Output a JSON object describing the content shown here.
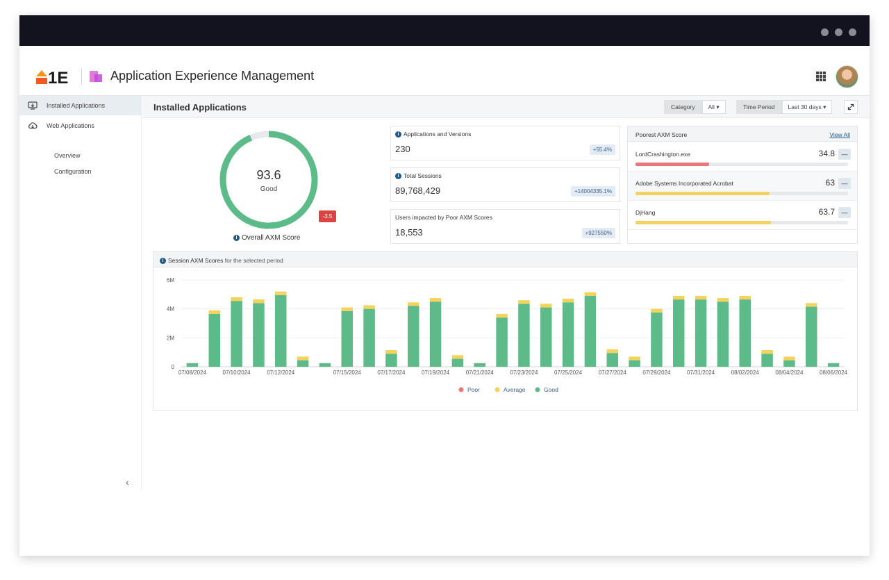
{
  "app": {
    "title": "Application Experience Management",
    "logo_text": "1E"
  },
  "sidebar": {
    "items": [
      {
        "label": "Installed Applications",
        "icon": "monitor-download-icon"
      },
      {
        "label": "Web Applications",
        "icon": "cloud-download-icon"
      }
    ],
    "subitems": [
      {
        "label": "Overview"
      },
      {
        "label": "Configuration"
      }
    ],
    "collapse_glyph": "‹"
  },
  "topbar": {
    "title": "Installed Applications",
    "category_label": "Category",
    "category_value": "All",
    "period_label": "Time Period",
    "period_value": "Last 30 days"
  },
  "score": {
    "value": "93.6",
    "rating": "Good",
    "delta": "-3.5",
    "caption": "Overall AXM Score",
    "fraction": 0.936,
    "color": "#5dbb8a"
  },
  "stats": [
    {
      "title": "Applications and Versions",
      "value": "230",
      "delta": "+55.4%",
      "info": true
    },
    {
      "title": "Total Sessions",
      "value": "89,768,429",
      "delta": "+14004335.1%",
      "info": true
    },
    {
      "title": "Users impacted by Poor AXM Scores",
      "value": "18,553",
      "delta": "+927550%",
      "info": false
    }
  ],
  "poorest": {
    "title": "Poorest AXM Score",
    "view_all": "View All",
    "rows": [
      {
        "name": "LordCrashington.exe",
        "score": "34.8",
        "fraction": 0.348,
        "color": "#e8787b"
      },
      {
        "name": "Adobe Systems Incorporated Acrobat",
        "score": "63",
        "fraction": 0.63,
        "color": "#f3d35e"
      },
      {
        "name": "DjHang",
        "score": "63.7",
        "fraction": 0.637,
        "color": "#f3d35e"
      }
    ],
    "button_glyph": "—"
  },
  "chart_title": {
    "bold": "Session AXM Scores",
    "rest": " for the selected period"
  },
  "chart_data": {
    "type": "bar",
    "stacked": true,
    "ylim": [
      0,
      6000000
    ],
    "yticks": [
      0,
      2000000,
      4000000,
      6000000
    ],
    "ytick_labels": [
      "0",
      "2M",
      "4M",
      "6M"
    ],
    "categories": [
      "07/08/2024",
      "07/09/2024",
      "07/10/2024",
      "07/11/2024",
      "07/12/2024",
      "07/13/2024",
      "07/14/2024",
      "07/15/2024",
      "07/16/2024",
      "07/17/2024",
      "07/18/2024",
      "07/19/2024",
      "07/20/2024",
      "07/21/2024",
      "07/22/2024",
      "07/23/2024",
      "07/24/2024",
      "07/25/2024",
      "07/26/2024",
      "07/27/2024",
      "07/28/2024",
      "07/29/2024",
      "07/30/2024",
      "07/31/2024",
      "08/01/2024",
      "08/02/2024",
      "08/03/2024",
      "08/04/2024",
      "08/05/2024",
      "08/06/2024"
    ],
    "xtick_labels": [
      "07/08/2024",
      "07/10/2024",
      "07/12/2024",
      "07/15/2024",
      "07/17/2024",
      "07/19/2024",
      "07/21/2024",
      "07/23/2024",
      "07/25/2024",
      "07/27/2024",
      "07/29/2024",
      "07/31/2024",
      "08/02/2024",
      "08/04/2024",
      "08/06/2024"
    ],
    "series": [
      {
        "name": "Poor",
        "color": "#e8787b",
        "values": [
          0,
          0,
          0,
          0,
          0,
          0,
          0,
          0,
          0,
          0,
          0,
          0,
          0,
          0,
          0,
          0,
          0,
          0,
          0,
          0,
          0,
          0,
          0,
          0,
          0,
          0,
          0,
          0,
          0,
          0
        ]
      },
      {
        "name": "Average",
        "color": "#f3d35e",
        "values": [
          0,
          250000,
          250000,
          250000,
          250000,
          250000,
          0,
          250000,
          250000,
          250000,
          250000,
          250000,
          250000,
          0,
          250000,
          250000,
          250000,
          250000,
          250000,
          250000,
          250000,
          250000,
          250000,
          250000,
          250000,
          250000,
          250000,
          250000,
          250000,
          0
        ]
      },
      {
        "name": "Good",
        "color": "#5dbb8a",
        "values": [
          250000,
          3650000,
          4550000,
          4400000,
          4950000,
          450000,
          250000,
          3850000,
          4000000,
          900000,
          4200000,
          4500000,
          550000,
          250000,
          3400000,
          4350000,
          4100000,
          4450000,
          4900000,
          950000,
          450000,
          3750000,
          4650000,
          4650000,
          4500000,
          4650000,
          900000,
          450000,
          4150000,
          250000
        ]
      }
    ],
    "legend_position": "bottom-center",
    "grid": true
  }
}
